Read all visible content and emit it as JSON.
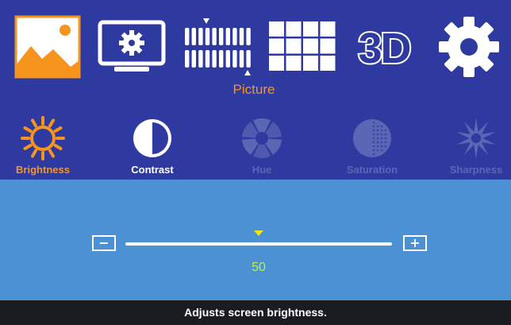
{
  "menu": {
    "categories": [
      {
        "id": "picture",
        "icon": "landscape-icon",
        "selected": true
      },
      {
        "id": "display",
        "icon": "monitor-gear-icon"
      },
      {
        "id": "geometry",
        "icon": "pixel-grid-icon"
      },
      {
        "id": "layout",
        "icon": "grid-icon"
      },
      {
        "id": "3d",
        "label": "3D",
        "icon": "3d-icon"
      },
      {
        "id": "setup",
        "icon": "gear-icon"
      }
    ],
    "selected_label": "Picture"
  },
  "submenu": {
    "items": [
      {
        "label": "Brightness",
        "icon": "sun-icon",
        "state": "selected"
      },
      {
        "label": "Contrast",
        "icon": "half-circle-icon",
        "state": "enabled"
      },
      {
        "label": "Hue",
        "icon": "hue-wheel-icon",
        "state": "disabled"
      },
      {
        "label": "Saturation",
        "icon": "saturation-icon",
        "state": "disabled"
      },
      {
        "label": "Sharpness",
        "icon": "sharpness-icon",
        "state": "disabled"
      }
    ]
  },
  "slider": {
    "minus_label": "−",
    "plus_label": "+",
    "value": "50",
    "level_fraction": 0.5
  },
  "footer": {
    "hint": "Adjusts screen brightness."
  },
  "colors": {
    "top_panel": "#2f3aa0",
    "adjust_panel": "#4c91d3",
    "accent_orange": "#f7941d",
    "value_green": "#b7f05a",
    "marker_yellow": "#f4e813",
    "disabled": "#5b66b4",
    "footer_bg": "#1b1b22"
  }
}
